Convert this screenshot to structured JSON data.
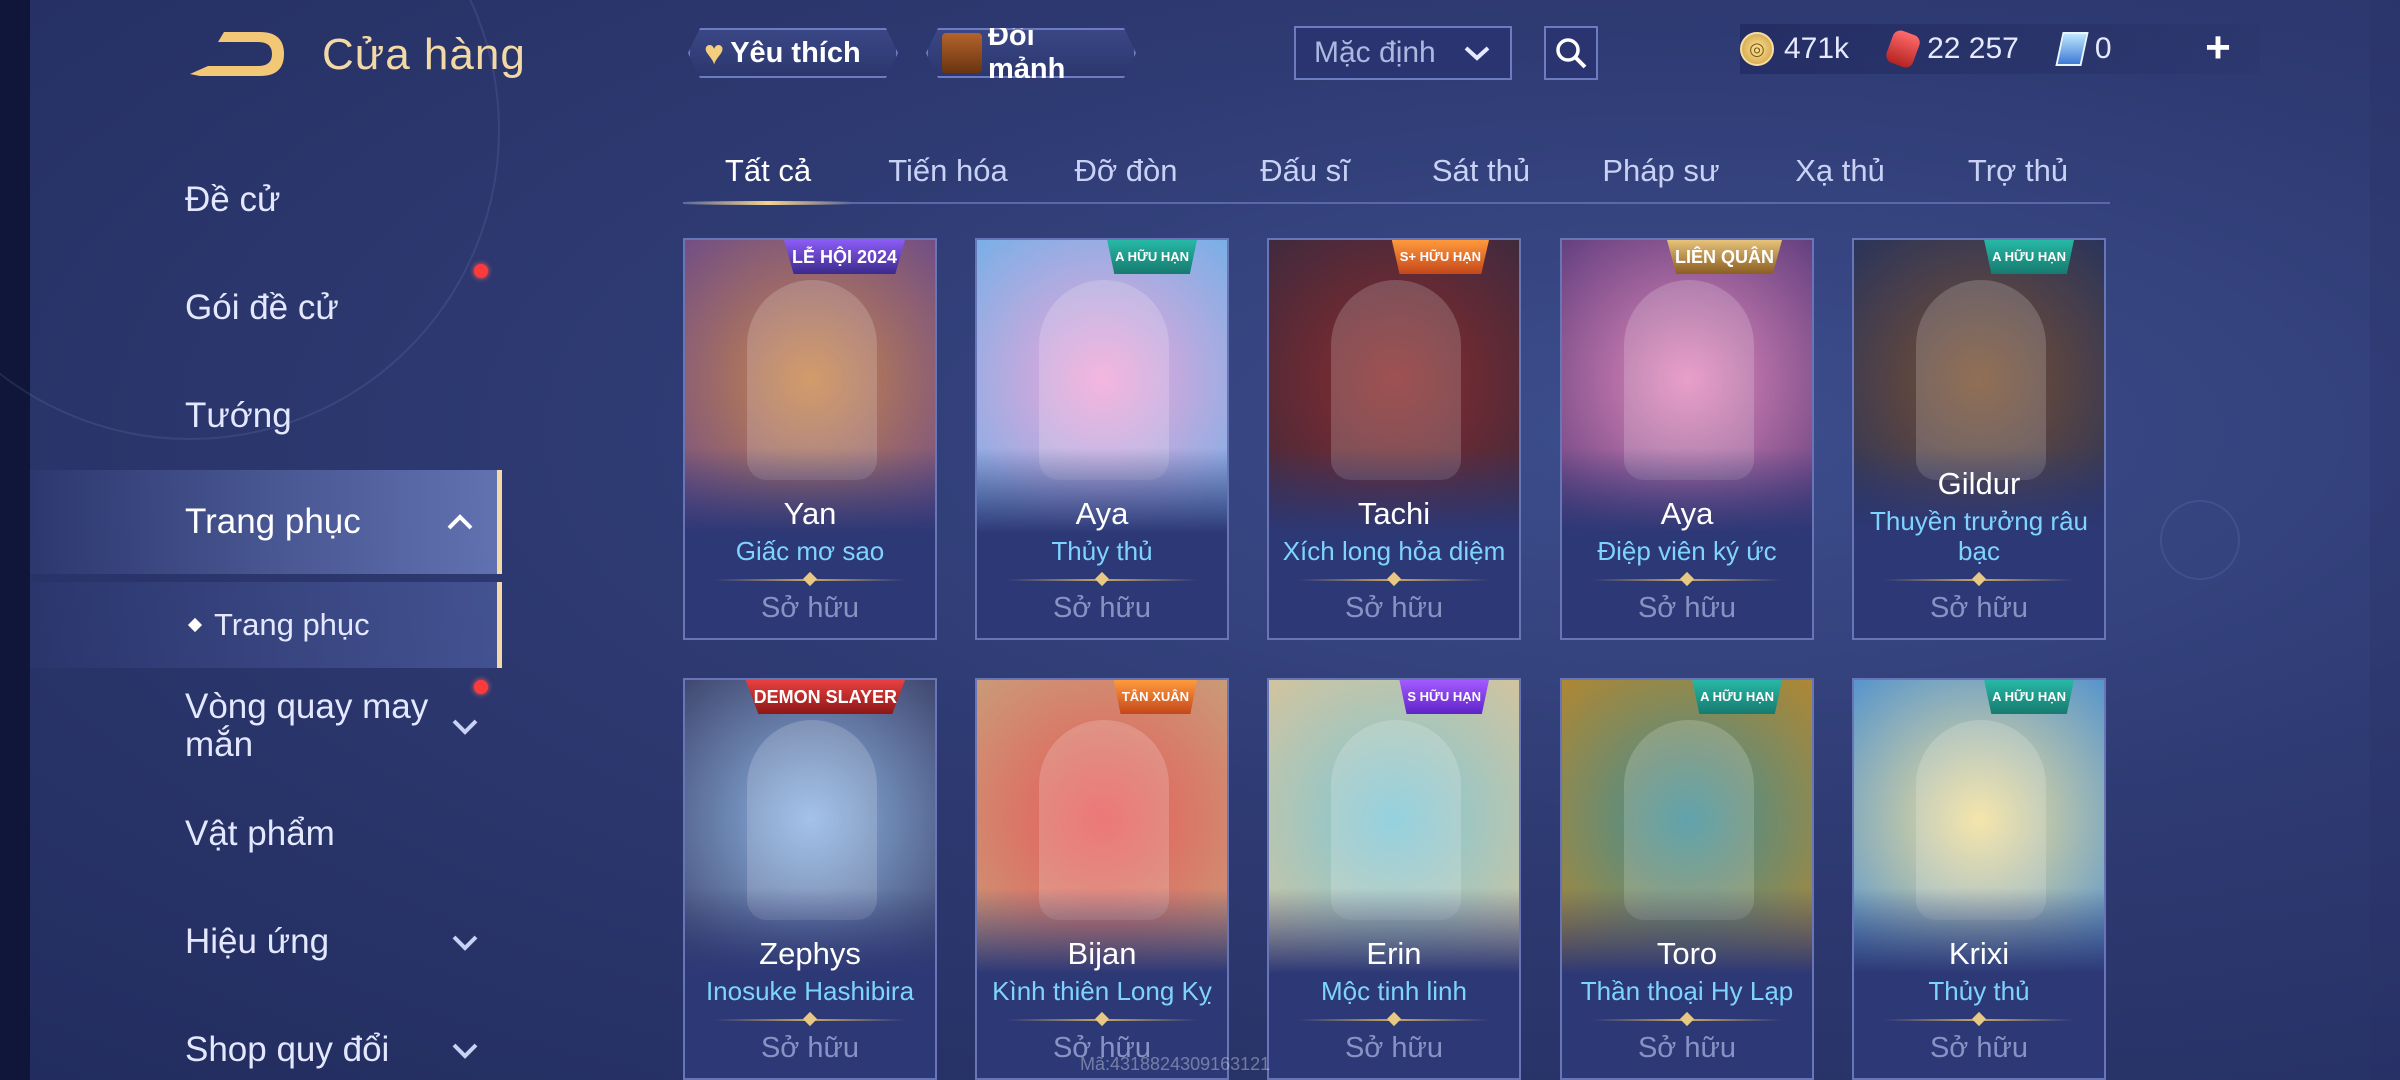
{
  "header": {
    "title": "Cửa hàng",
    "favorite_label": "Yêu thích",
    "exchange_shards_label": "Đổi mảnh",
    "sort": {
      "selected": "Mặc định"
    },
    "wallet": {
      "gold": "471k",
      "vouchers": "22 257",
      "gems": "0"
    },
    "add_label": "+"
  },
  "sidebar": {
    "items": [
      {
        "label": "Đề cử"
      },
      {
        "label": "Gói đề cử",
        "has_notification": true
      },
      {
        "label": "Tướng"
      },
      {
        "label": "Trang phục",
        "expanded": true
      },
      {
        "label": "Trang phục"
      },
      {
        "label": "Vòng quay may mắn",
        "has_notification": true
      },
      {
        "label": "Vật phẩm"
      },
      {
        "label": "Hiệu ứng"
      },
      {
        "label": "Shop quy đổi"
      }
    ]
  },
  "tabs": [
    {
      "label": "Tất cả",
      "active": true
    },
    {
      "label": "Tiến hóa"
    },
    {
      "label": "Đỡ đòn"
    },
    {
      "label": "Đấu sĩ"
    },
    {
      "label": "Sát thủ"
    },
    {
      "label": "Pháp sư"
    },
    {
      "label": "Xạ thủ"
    },
    {
      "label": "Trợ thủ"
    }
  ],
  "cards": [
    {
      "hero": "Yan",
      "skin": "Giấc mơ sao",
      "status": "Sở hữu",
      "badge": "LỄ HỘI 2024",
      "badge_style": "event",
      "art_colors": [
        "#c9864a",
        "#6b4a8a"
      ]
    },
    {
      "hero": "Aya",
      "skin": "Thủy thủ",
      "status": "Sở hữu",
      "badge": "A HỮU HẠN",
      "badge_style": "teal",
      "art_colors": [
        "#f2a6d8",
        "#6fb0e8"
      ]
    },
    {
      "hero": "Tachi",
      "skin": "Xích long hỏa diệm",
      "status": "Sở hữu",
      "badge": "S+ HỮU HẠN",
      "badge_style": "orange",
      "art_colors": [
        "#8a2b2b",
        "#3a2a3f"
      ]
    },
    {
      "hero": "Aya",
      "skin": "Điệp viên ký ức",
      "status": "Sở hữu",
      "badge": "LIÊN QUÂN",
      "badge_style": "gold",
      "art_colors": [
        "#e48bbd",
        "#5a3a7a"
      ]
    },
    {
      "hero": "Gildur",
      "skin": "Thuyền trưởng râu bạc",
      "status": "Sở hữu",
      "badge": "A HỮU HẠN",
      "badge_style": "teal",
      "art_colors": [
        "#7a5030",
        "#24325e"
      ]
    },
    {
      "hero": "Zephys",
      "skin": "Inosuke Hashibira",
      "status": "Sở hữu",
      "badge": "DEMON SLAYER",
      "badge_style": "red",
      "art_colors": [
        "#8fb6e6",
        "#3a3f66"
      ]
    },
    {
      "hero": "Bijan",
      "skin": "Kình thiên Long Kỵ",
      "status": "Sở hữu",
      "badge": "TÂN XUÂN",
      "badge_style": "orange",
      "art_colors": [
        "#e85a5a",
        "#c7a07a"
      ]
    },
    {
      "hero": "Erin",
      "skin": "Mộc tinh linh",
      "status": "Sở hữu",
      "badge": "S HỮU HẠN",
      "badge_style": "purple",
      "art_colors": [
        "#7ec7d8",
        "#d8c49a"
      ]
    },
    {
      "hero": "Toro",
      "skin": "Thần thoại Hy Lạp",
      "status": "Sở hữu",
      "badge": "A HỮU HẠN",
      "badge_style": "teal",
      "art_colors": [
        "#3e8f9a",
        "#b8862a"
      ]
    },
    {
      "hero": "Krixi",
      "skin": "Thủy thủ",
      "status": "Sở hữu",
      "badge": "A HỮU HẠN",
      "badge_style": "teal",
      "art_colors": [
        "#f3e09a",
        "#4a8fd0"
      ]
    }
  ],
  "watermark": "Mã:4318824309163121"
}
